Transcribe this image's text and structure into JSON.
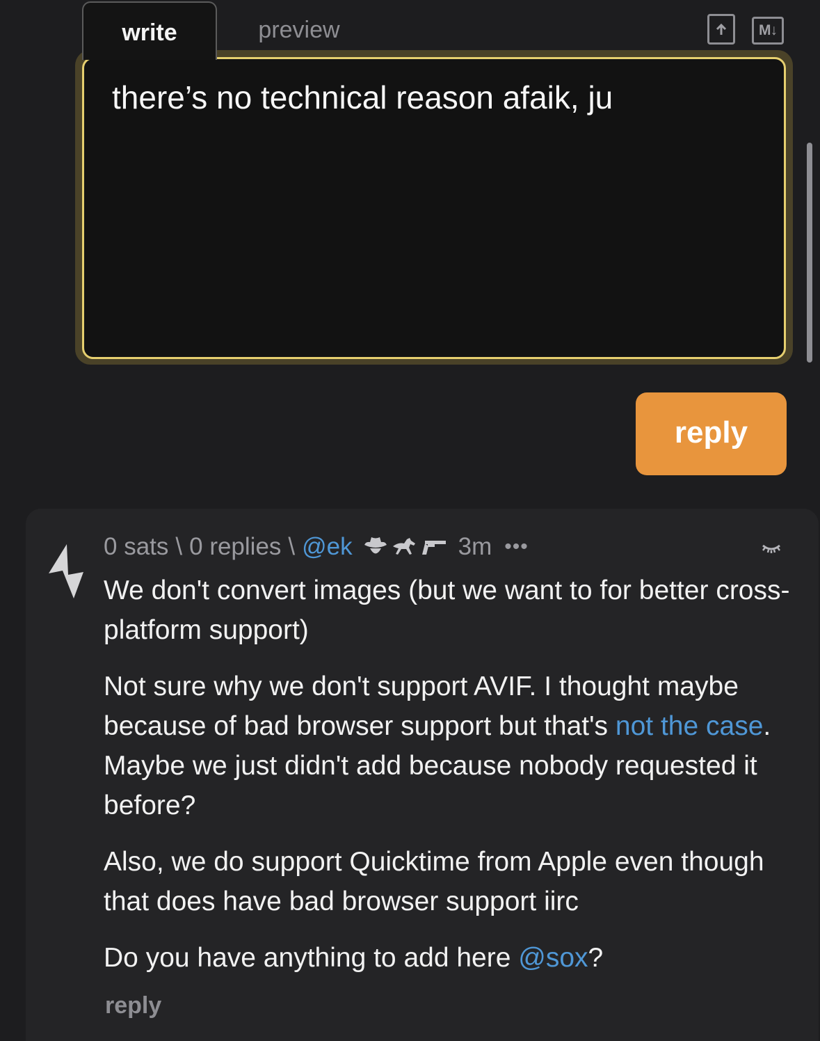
{
  "editor": {
    "tabs": {
      "write": "write",
      "preview": "preview"
    },
    "toolbar": {
      "upload_icon": "upload-file-icon",
      "markdown_label": "M↓"
    },
    "text": "there’s no technical reason afaik, ju",
    "submit_label": "reply"
  },
  "comment": {
    "sats": "0 sats",
    "sep1": "\\",
    "replies": "0 replies",
    "sep2": "\\",
    "user": "@ek",
    "badges": [
      "cowboy-hat-icon",
      "horse-icon",
      "gun-icon"
    ],
    "age": "3m",
    "more": "•••",
    "paragraphs": {
      "p1": "We don't convert images (but we want to for better cross-platform support)",
      "p2_before": "Not sure why we don't support AVIF. I thought maybe because of bad browser support but that's ",
      "p2_link": "not the case",
      "p2_after": ". Maybe we just didn't add because nobody requested it before?",
      "p3": "Also, we do support Quicktime from Apple even though that does have bad browser support iirc",
      "p4_before": "Do you have anything to add here ",
      "p4_mention": "@sox",
      "p4_after": "?"
    },
    "reply_label": "reply"
  },
  "colors": {
    "accent": "#e8953d",
    "link": "#4f97d6",
    "editor_border": "#e6cf6f",
    "background": "#1d1d1f",
    "card": "#242426"
  }
}
